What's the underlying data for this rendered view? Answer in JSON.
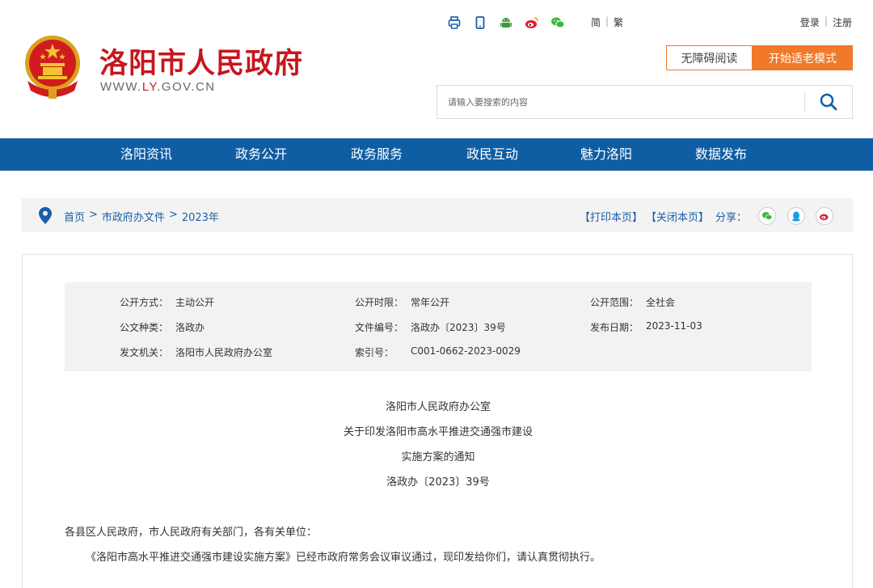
{
  "header": {
    "site_title": "洛阳市人民政府",
    "site_url_prefix": "WWW.",
    "site_url_mid": "LY",
    "site_url_suffix": ".GOV.CN",
    "top_icons": [
      "print-icon",
      "mobile-icon",
      "android-robot-icon",
      "weibo-icon",
      "wechat-icon"
    ],
    "lang_simplified": "简",
    "lang_traditional": "繁",
    "login": "登录",
    "register": "注册",
    "accessible_reading": "无障碍阅读",
    "elder_mode": "开始适老模式",
    "search_placeholder": "请输入要搜索的内容"
  },
  "nav": [
    "洛阳资讯",
    "政务公开",
    "政务服务",
    "政民互动",
    "魅力洛阳",
    "数据发布"
  ],
  "breadcrumb": {
    "items": [
      "首页",
      "市政府办文件",
      "2023年"
    ],
    "separator": ">",
    "print": "【打印本页】",
    "close": "【关闭本页】",
    "share": "分享："
  },
  "meta": {
    "rows": [
      [
        {
          "k": "公开方式：",
          "v": "主动公开"
        },
        {
          "k": "公开时限：",
          "v": "常年公开"
        },
        {
          "k": "公开范围：",
          "v": "全社会"
        }
      ],
      [
        {
          "k": "公文种类：",
          "v": "洛政办"
        },
        {
          "k": "文件编号：",
          "v": "洛政办〔2023〕39号"
        },
        {
          "k": "发布日期：",
          "v": "2023-11-03"
        }
      ],
      [
        {
          "k": "发文机关：",
          "v": "洛阳市人民政府办公室"
        },
        {
          "k": "索引号：",
          "v": "C001-0662-2023-0029"
        },
        {
          "k": "",
          "v": ""
        }
      ]
    ]
  },
  "document": {
    "issuer": "洛阳市人民政府办公室",
    "title_line1": "关于印发洛阳市高水平推进交通强市建设",
    "title_line2": "实施方案的通知",
    "doc_number": "洛政办〔2023〕39号",
    "salutation": "各县区人民政府，市人民政府有关部门，各有关单位：",
    "paragraph1": "《洛阳市高水平推进交通强市建设实施方案》已经市政府常务会议审议通过，现印发给你们，请认真贯彻执行。"
  },
  "colors": {
    "brand_red": "#c8161d",
    "nav_blue": "#0f5ea4",
    "accent_orange": "#f07a2a",
    "link_blue": "#1a5ea8"
  }
}
